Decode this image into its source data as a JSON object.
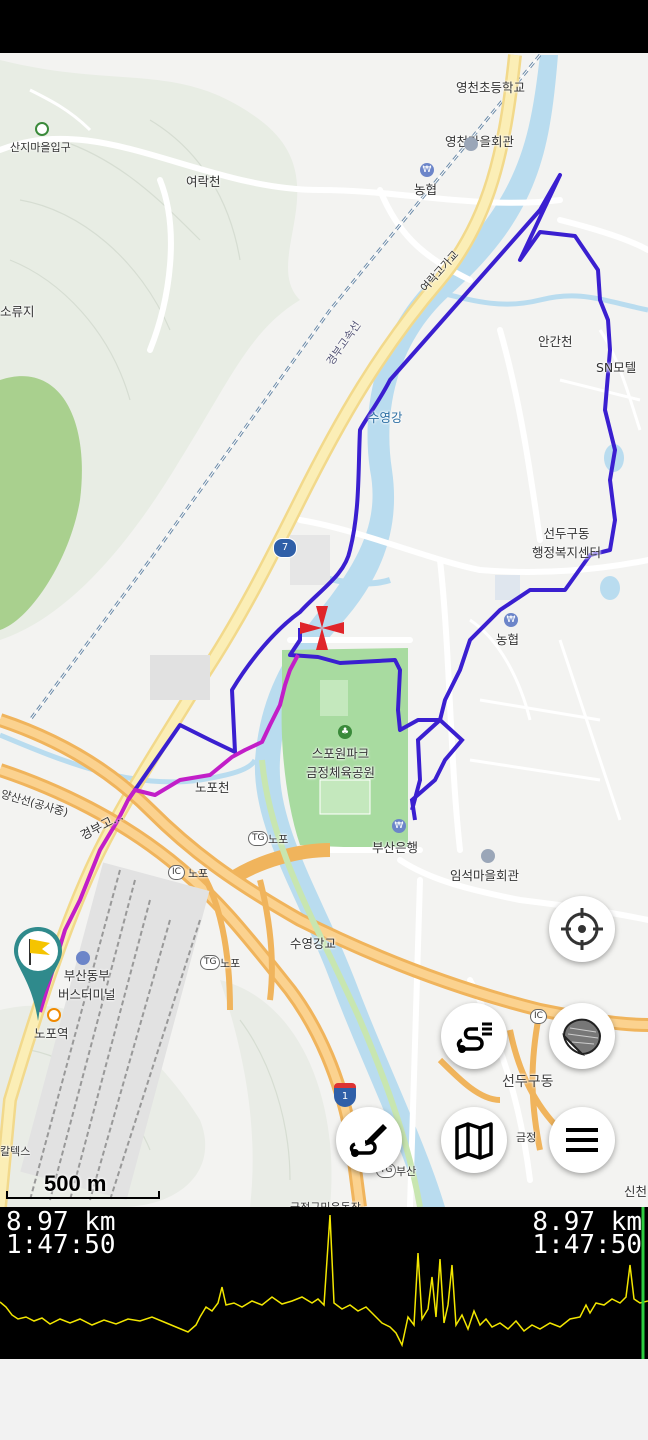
{
  "map": {
    "places": {
      "yeongcheon_school": "영천초등학교",
      "yeongcheon_hall": "영천마을회관",
      "nonghyup_1": "농협",
      "yeorakcheon": "여락천",
      "sanji_entrance": "산지마을입구",
      "soryuji": "소류지",
      "yeorak_bridge": "여락고가교",
      "gyeongbu_exp": "경부고속선",
      "angancheon": "안간천",
      "sn_motel": "SN모텔",
      "suyeonggang": "수영강",
      "seondugu_office": "선두구동\n행정복지센터",
      "nonghyup_2": "농협",
      "sports_park": "스포원파크\n금정체육공원",
      "nopocheon": "노포천",
      "busan_bank": "부산은행",
      "imseok_hall": "임석마을회관",
      "gyeongbu_road": "경부고...",
      "yangsan_line": "양산선(공사중)",
      "nopo_ic": "노포",
      "nopo_tg": "노포",
      "nopo_tg2": "노포",
      "suyeonggang_bridge": "수영강교",
      "bus_terminal": "부산동부\n버스터미널",
      "nopo_station": "노포역",
      "seondugu_dong": "선두구동",
      "geumjeong": "금정",
      "busan_small": "부산",
      "caltex": "칼텍스",
      "geumjeong_bottom": "금정구민운동장",
      "sincheon": "신천",
      "route7": "7",
      "route1": "1",
      "ic_label": "IC",
      "tg_label": "TG"
    },
    "scale_label": "500 m",
    "track_colors": {
      "recorded": "#3a1fd0",
      "current": "#c21ec8",
      "target": "#e0252a"
    }
  },
  "buttons": {
    "locate": "crosshair-icon",
    "track_list": "route-list-icon",
    "layers": "layers-icon",
    "draw_route": "route-edit-icon",
    "map": "map-icon",
    "menu": "hamburger-icon"
  },
  "stats": {
    "distance_left": "8.97 km",
    "time_left": "1:47:50",
    "distance_right": "8.97 km",
    "time_right": "1:47:50"
  },
  "elevation": {
    "line_color": "#f2e600",
    "cursor_color": "#2ecc40"
  }
}
